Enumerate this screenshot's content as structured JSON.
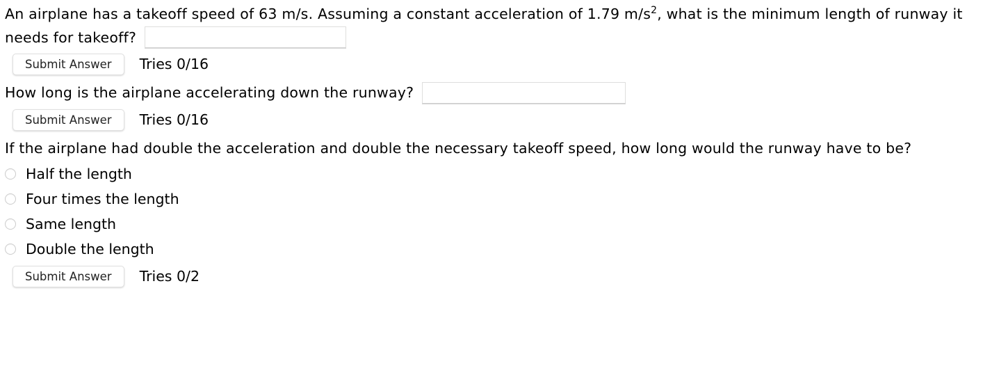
{
  "questions": [
    {
      "id": "q1",
      "text_before": "An airplane has a takeoff speed of 63 m/s. Assuming a constant acceleration of 1.79 m/s",
      "exponent": "2",
      "text_after": ", what is the minimum length of runway it needs for takeoff?",
      "answer_value": "",
      "answer_placeholder": "",
      "submit_label": "Submit Answer",
      "tries_label": "Tries 0/16"
    },
    {
      "id": "q2",
      "text_before": "How long is the airplane accelerating down the runway?",
      "exponent": "",
      "text_after": "",
      "answer_value": "",
      "answer_placeholder": "",
      "submit_label": "Submit Answer",
      "tries_label": "Tries 0/16"
    },
    {
      "id": "q3",
      "text_before": "If the airplane had double the acceleration and double the necessary takeoff speed, how long would the runway have to be?",
      "exponent": "",
      "text_after": "",
      "submit_label": "Submit Answer",
      "tries_label": "Tries 0/2",
      "options": [
        {
          "label": "Half the length",
          "selected": false
        },
        {
          "label": "Four times the length",
          "selected": false
        },
        {
          "label": "Same length",
          "selected": false
        },
        {
          "label": "Double the length",
          "selected": false
        }
      ]
    }
  ],
  "colors": {
    "text": "#000000",
    "button_text": "#222222",
    "input_border": "#dededd",
    "radio_border": "#cccccc",
    "background": "#ffffff"
  }
}
